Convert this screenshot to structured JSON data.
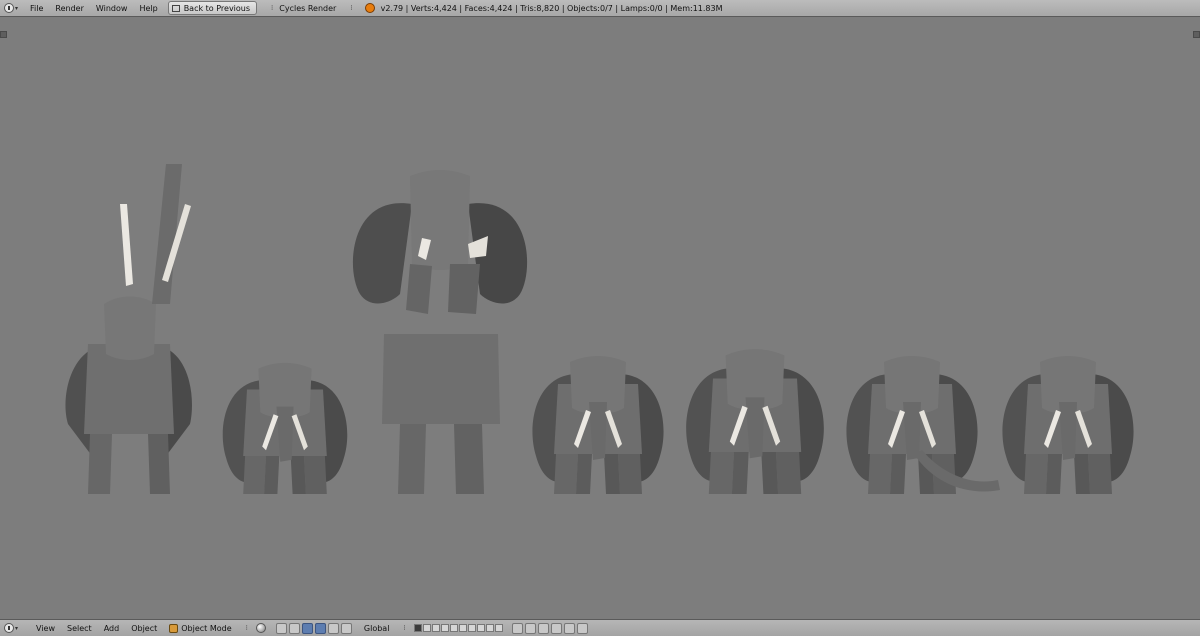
{
  "header": {
    "menus": [
      "File",
      "Render",
      "Window",
      "Help"
    ],
    "back_button": "Back to Previous",
    "render_engine": "Cycles Render",
    "stats": "v2.79 | Verts:4,424 | Faces:4,424 | Tris:8,820 | Objects:0/7 | Lamps:0/0 | Mem:11.83M"
  },
  "footer": {
    "menus": [
      "View",
      "Select",
      "Add",
      "Object"
    ],
    "mode": "Object Mode",
    "orientation": "Global"
  },
  "colors": {
    "viewport_bg": "#7d7d7d",
    "elephant_body": "#707070",
    "elephant_ear": "#545454",
    "tusk": "#ebe8e2"
  }
}
